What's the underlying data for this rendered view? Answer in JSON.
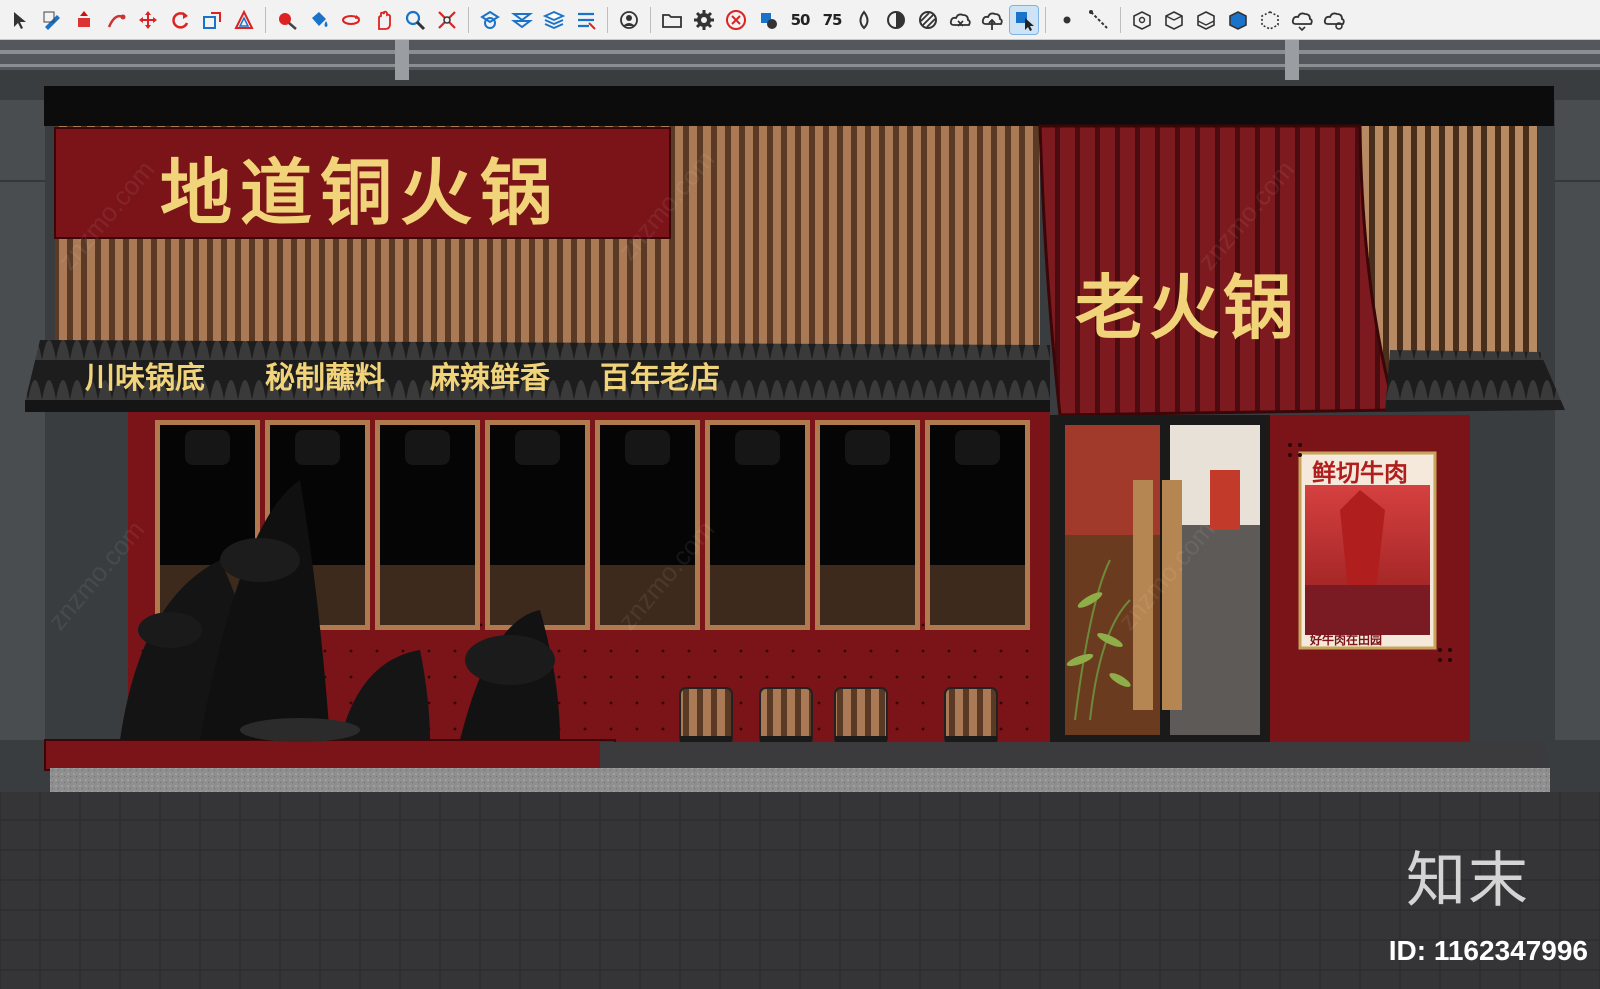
{
  "toolbar": {
    "items": [
      {
        "name": "select-dropdown-icon"
      },
      {
        "name": "draw-dropdown-icon"
      },
      {
        "name": "push-pull-icon"
      },
      {
        "name": "follow-me-icon"
      },
      {
        "name": "move-icon"
      },
      {
        "name": "rotate-icon"
      },
      {
        "name": "scale-icon"
      },
      {
        "name": "offset-icon"
      },
      {
        "name": "tape-measure-icon"
      },
      {
        "name": "paint-bucket-icon"
      },
      {
        "name": "orbit-icon"
      },
      {
        "name": "pan-icon"
      },
      {
        "name": "zoom-icon"
      },
      {
        "name": "zoom-extents-icon"
      },
      {
        "name": "layer-icon"
      },
      {
        "name": "layers-merge-icon"
      },
      {
        "name": "layers-stack-icon"
      },
      {
        "name": "layers-filter-icon"
      },
      {
        "name": "user-dropdown-icon"
      },
      {
        "name": "folder-icon"
      },
      {
        "name": "gear-icon"
      },
      {
        "name": "close-circle-icon"
      },
      {
        "name": "render-icon"
      },
      {
        "name": "zoom-50-icon",
        "label": "50"
      },
      {
        "name": "zoom-75-icon",
        "label": "75"
      },
      {
        "name": "drop-icon"
      },
      {
        "name": "contrast-icon"
      },
      {
        "name": "hatch-icon"
      },
      {
        "name": "cloud-x-icon"
      },
      {
        "name": "cloud-upload-icon"
      },
      {
        "name": "cursor-cube-icon"
      },
      {
        "name": "point-icon"
      },
      {
        "name": "dashed-line-icon"
      },
      {
        "name": "view-iso-icon"
      },
      {
        "name": "view-top-icon"
      },
      {
        "name": "view-front-icon"
      },
      {
        "name": "view-right-icon"
      },
      {
        "name": "view-back-icon"
      },
      {
        "name": "cloud-sync-icon"
      },
      {
        "name": "cloud-settings-icon"
      }
    ]
  },
  "scene": {
    "main_sign": "地道铜火锅",
    "tile_sign": "老火锅",
    "slogans": [
      "川味锅底",
      "秘制蘸料",
      "麻辣鲜香",
      "百年老店"
    ],
    "poster_title": "鲜切牛肉",
    "poster_footer": "好牛肉在田园",
    "watermark": "znzmo.com",
    "brand_mark": "知末",
    "id_label": "ID: 1162347996",
    "colors": {
      "lacquer_red": "#7a1419",
      "gold_text": "#f1d37a",
      "wood": "#8b5e3c",
      "sky": "#3a3d40"
    }
  }
}
